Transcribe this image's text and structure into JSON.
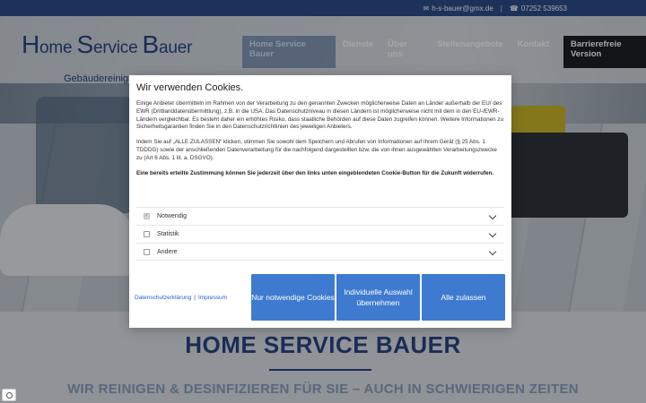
{
  "topbar": {
    "email": "h-s-bauer@gmx.de",
    "separator": "|",
    "phone": "07252 539653"
  },
  "logo": {
    "main_h": "H",
    "main_ome": "ome ",
    "main_s": "S",
    "main_ervice": "ervice ",
    "main_b": "B",
    "main_auer": "auer",
    "sub": "Gebäudereinigung"
  },
  "nav": {
    "items": [
      {
        "label": "Home Service Bauer"
      },
      {
        "label": "Dienste"
      },
      {
        "label": "Über uns"
      },
      {
        "label": "Stellenangebote"
      },
      {
        "label": "Kontakt"
      },
      {
        "label": "Barrierefreie Version"
      }
    ]
  },
  "page": {
    "heading": "HOME SERVICE BAUER",
    "subheading": "WIR REINIGEN & DESINFIZIEREN FÜR SIE – AUCH IN SCHWIERIGEN ZEITEN"
  },
  "cookie_dialog": {
    "title": "Wir verwenden Cookies.",
    "para1": "Einige Anbieter übermitteln im Rahmen von der Verarbeitung zu den genannten Zwecken möglicherweise Daten an Länder außerhalb der EU/ des EWR (Drittlanddatenübermittlung), z.B. in die USA. Das Datenschutzniveau in diesen Ländern ist möglicherweise nicht mit dem in den EU-/EWR-Ländern vergleichbar. Es besteht daher ein erhöhtes Risiko, dass staatliche Behörden auf diese Daten zugreifen können. Weitere Informationen zu Sicherheitsgarantien finden Sie in den Datenschutzrichtlinien des jeweiligen Anbieters.",
    "para2": "Indem Sie auf „ALLE ZULASSEN“ klicken, stimmen Sie sowohl dem Speichern und Abrufen von Informationen auf Ihrem Gerät (§ 25 Abs. 1 TDDDG) sowie der anschließenden Datenverarbeitung für die nachfolgend dargestellten bzw. die von ihnen ausgewählten Verarbeitungszwecke zu (Art 6 Abs. 1 lit. a. DSGVO).",
    "para3": "Eine bereits erteilte Zustimmung können Sie jederzeit über den links unten eingeblendeten Cookie-Button für die Zukunft widerrufen.",
    "options": [
      {
        "label": "Notwendig",
        "checked": true
      },
      {
        "label": "Statistik",
        "checked": false
      },
      {
        "label": "Andere",
        "checked": false
      }
    ],
    "link_privacy": "Datenschutzerklärung",
    "link_divider": "|",
    "link_imprint": "Impressum",
    "btn_necessary": "Nur notwendige Cookies",
    "btn_individual": "Individuelle Auswahl übernehmen",
    "btn_all": "Alle zulassen",
    "accent_color": "#3e7bd0"
  }
}
